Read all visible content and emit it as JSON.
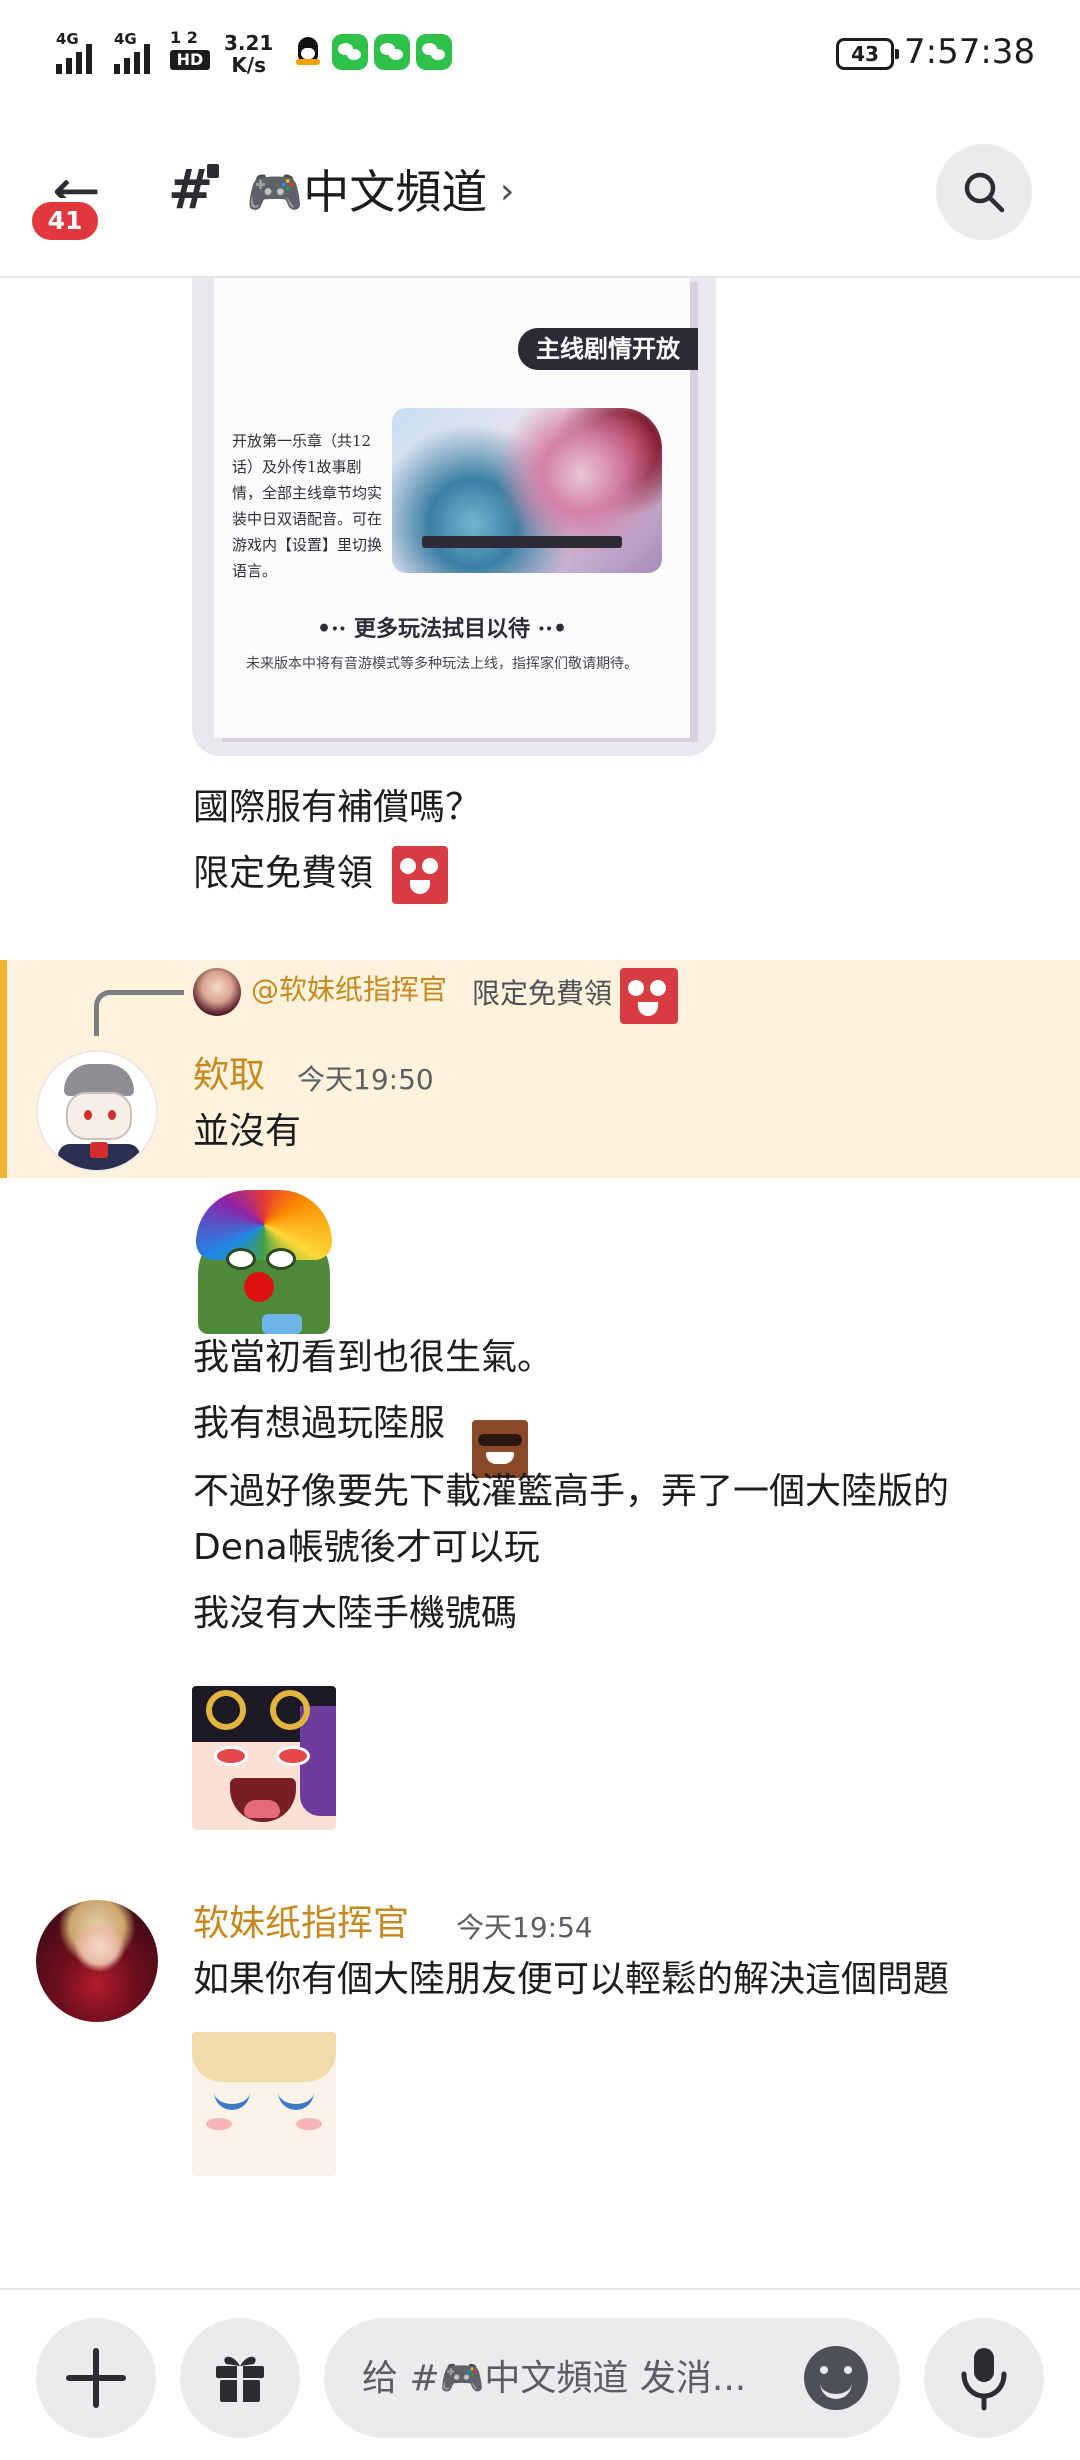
{
  "status_bar": {
    "signal1": "4G",
    "signal2": "4G",
    "hd_top": "1 2",
    "hd_bottom": "HD",
    "net_speed_value": "3.21",
    "net_speed_unit": "K/s",
    "battery": "43",
    "time": "7:57:38"
  },
  "header": {
    "back_badge": "41",
    "channel_title": "🎮中文頻道",
    "chevron": "›"
  },
  "messages": {
    "image_attachment": {
      "banner": "主线剧情开放",
      "description": "开放第一乐章（共12话）及外传1故事剧情，全部主线章节均实装中日双语配音。可在游戏内【设置】里切换语言。",
      "more": "•·· 更多玩法拭目以待 ··•",
      "note": "未来版本中将有音游模式等多种玩法上线，指挥家们敬请期待。"
    },
    "line1": "國際服有補償嗎？",
    "line2": "限定免費領",
    "reply": {
      "ref_author": "@软妹纸指挥官",
      "ref_preview": "限定免費領",
      "author": "欸取",
      "timestamp": "今天19:50",
      "text": "並沒有"
    },
    "after1": "我當初看到也很生氣。",
    "after2": "我有想過玩陸服",
    "after3a": "不過好像要先下載灌籃高手，弄了一個大陸版的",
    "after3b": "Dena帳號後才可以玩",
    "after4": "我沒有大陸手機號碼",
    "second": {
      "author": "软妹纸指挥官",
      "timestamp": "今天19:54",
      "text": "如果你有個大陸朋友便可以輕鬆的解決這個問題"
    }
  },
  "input_bar": {
    "placeholder": "给 #🎮中文頻道 发消..."
  },
  "colors": {
    "author": "#c7881d",
    "highlight_bg": "#fdf3dc",
    "highlight_border": "#f0b232",
    "badge": "#e0383e"
  }
}
